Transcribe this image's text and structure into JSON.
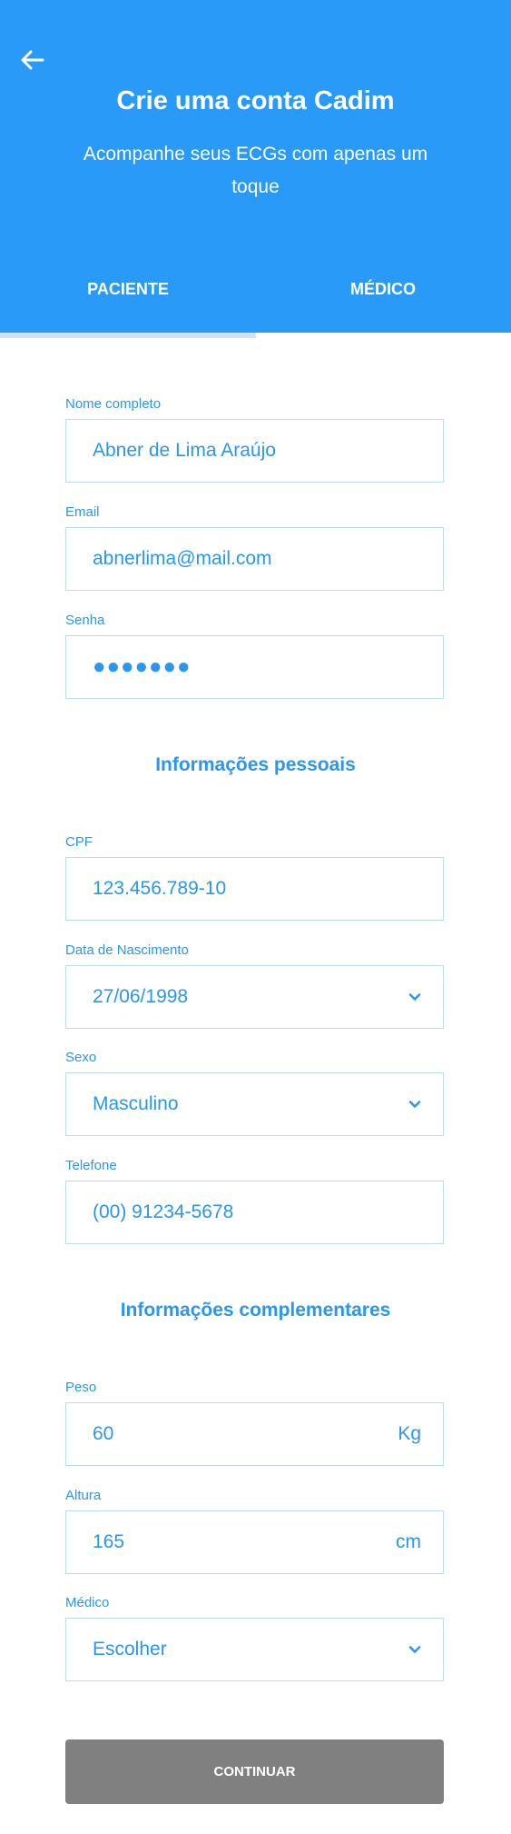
{
  "header": {
    "title": "Crie uma conta Cadim",
    "subtitle": "Acompanhe seus ECGs com apenas um toque",
    "background_color": "#2a9af8"
  },
  "tabs": [
    {
      "label": "PACIENTE",
      "active": true
    },
    {
      "label": "MÉDICO",
      "active": false
    }
  ],
  "form": {
    "nome": {
      "label": "Nome completo",
      "value": "Abner de Lima Araújo"
    },
    "email": {
      "label": "Email",
      "value": "abnerlima@mail.com"
    },
    "senha": {
      "label": "Senha",
      "value": "●●●●●●●"
    },
    "section_personal": "Informações pessoais",
    "cpf": {
      "label": "CPF",
      "value": "123.456.789-10"
    },
    "nascimento": {
      "label": "Data de Nascimento",
      "value": "27/06/1998"
    },
    "sexo": {
      "label": "Sexo",
      "value": "Masculino"
    },
    "telefone": {
      "label": "Telefone",
      "value": "(00) 91234-5678"
    },
    "section_complementary": "Informações complementares",
    "peso": {
      "label": "Peso",
      "value": "60",
      "unit": "Kg"
    },
    "altura": {
      "label": "Altura",
      "value": "165",
      "unit": "cm"
    },
    "medico": {
      "label": "Médico",
      "value": "Escolher"
    }
  },
  "continue_label": "CONTINUAR",
  "colors": {
    "accent": "#2a96ee",
    "button": "#808080",
    "field_border": "#bcdcf6"
  },
  "icons": {
    "back": "arrow-left-icon",
    "dropdown": "chevron-down-icon"
  }
}
